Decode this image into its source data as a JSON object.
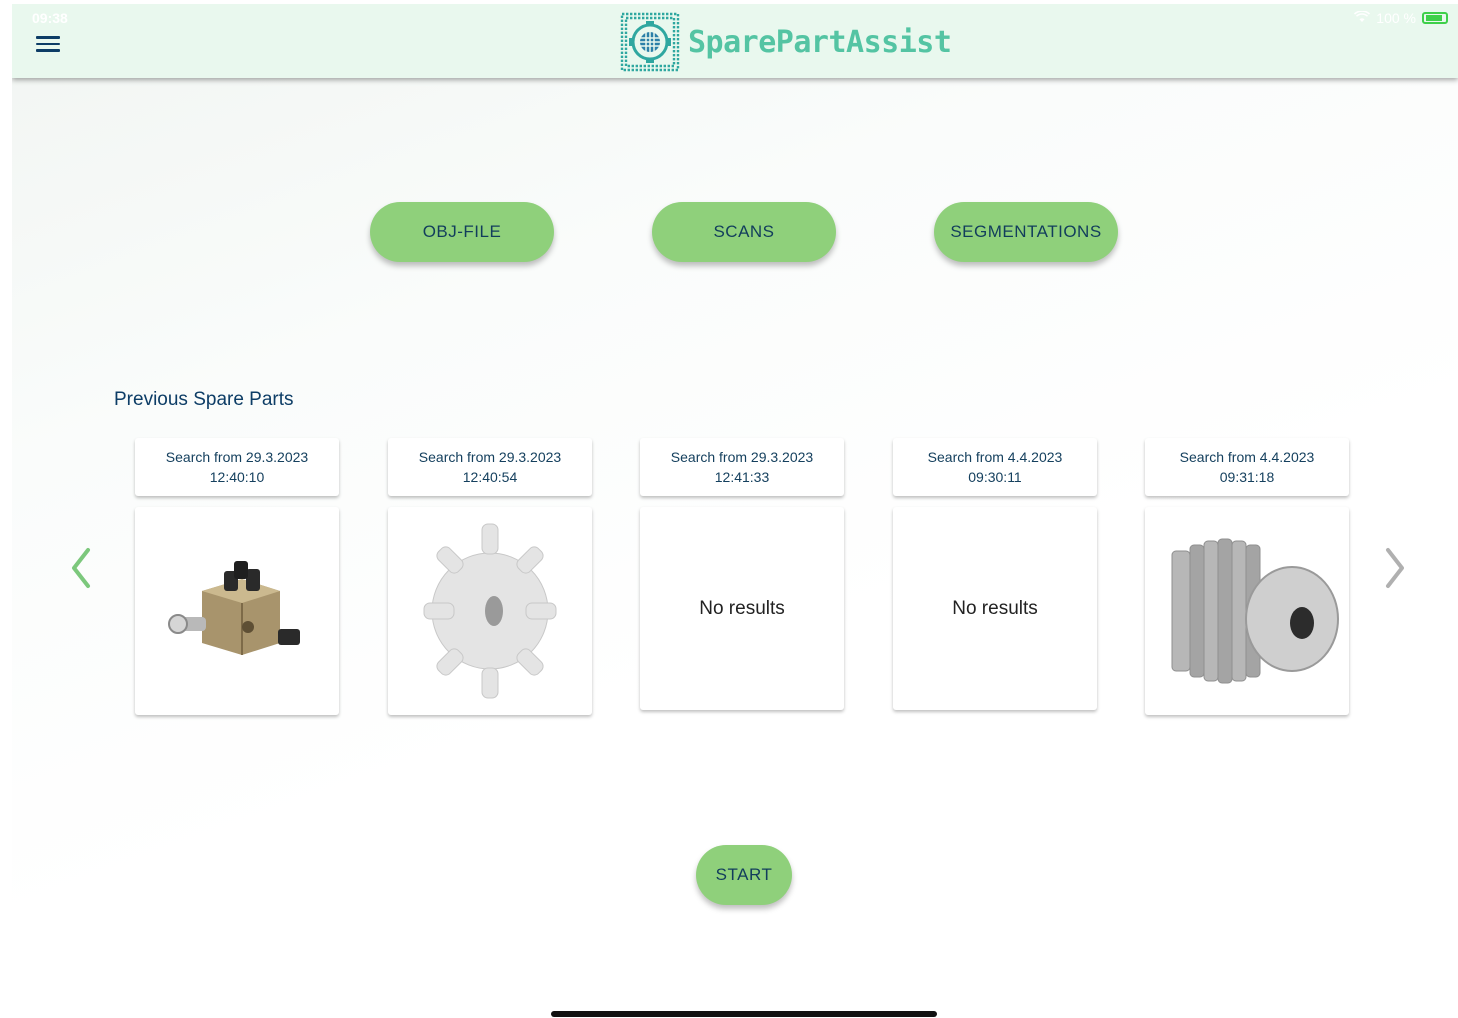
{
  "status": {
    "time": "09:38",
    "battery": "100 %"
  },
  "app": {
    "name": "SparePartAssist"
  },
  "buttons": {
    "obj_file": "OBJ-FILE",
    "scans": "SCANS",
    "segmentations": "SEGMENTATIONS",
    "start": "START"
  },
  "previous": {
    "title": "Previous Spare Parts",
    "items": [
      {
        "label": "Search from 29.3.2023",
        "time": "12:40:10",
        "result": "",
        "image": "valve-block"
      },
      {
        "label": "Search from 29.3.2023",
        "time": "12:40:54",
        "result": "",
        "image": "sprocket"
      },
      {
        "label": "Search from 29.3.2023",
        "time": "12:41:33",
        "result": "No results",
        "image": ""
      },
      {
        "label": "Search from 4.4.2023",
        "time": "09:30:11",
        "result": "No results",
        "image": ""
      },
      {
        "label": "Search from 4.4.2023",
        "time": "09:31:18",
        "result": "",
        "image": "spur-gear"
      }
    ]
  },
  "colors": {
    "appbar": "#e9f8ee",
    "button": "#8fd07b",
    "brand": "#54c4a3",
    "text": "#0d3d66",
    "arrow_left": "#7cc87c",
    "arrow_right": "#b0b0b0"
  }
}
